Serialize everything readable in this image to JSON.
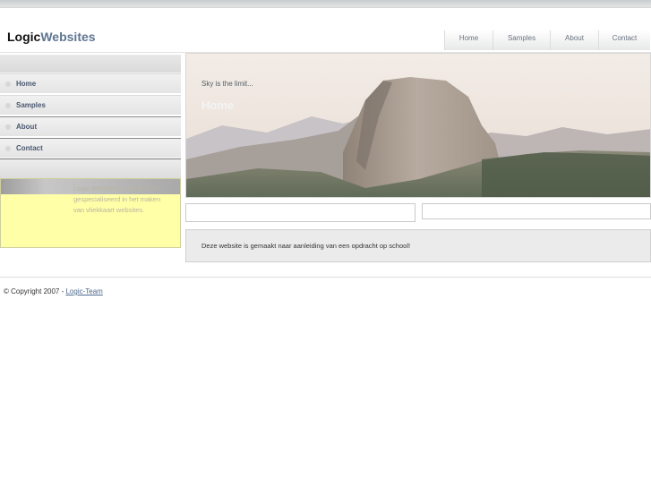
{
  "logo": {
    "part1": "Logic",
    "part2": "Websites"
  },
  "topnav": [
    "Home",
    "Samples",
    "About",
    "Contact"
  ],
  "sidebar": {
    "items": [
      {
        "label": "Home"
      },
      {
        "label": "Samples"
      },
      {
        "label": "About"
      },
      {
        "label": "Contact"
      }
    ],
    "intro": "Logic Websites is sinds 2007 gespecialiseerd in het maken van vliekkaart websites."
  },
  "hero": {
    "tagline": "Sky is the limit...",
    "title": "Home"
  },
  "content": {
    "text": "Deze website is gemaakt naar aanleiding van een opdracht op school!"
  },
  "footer": {
    "prefix": "© Copyright 2007 - ",
    "link": "Logic-Team"
  },
  "colors": {
    "logo_accent": "#5f7590",
    "intro_bg": "#ffffa8",
    "content_bg": "#ebebeb"
  }
}
